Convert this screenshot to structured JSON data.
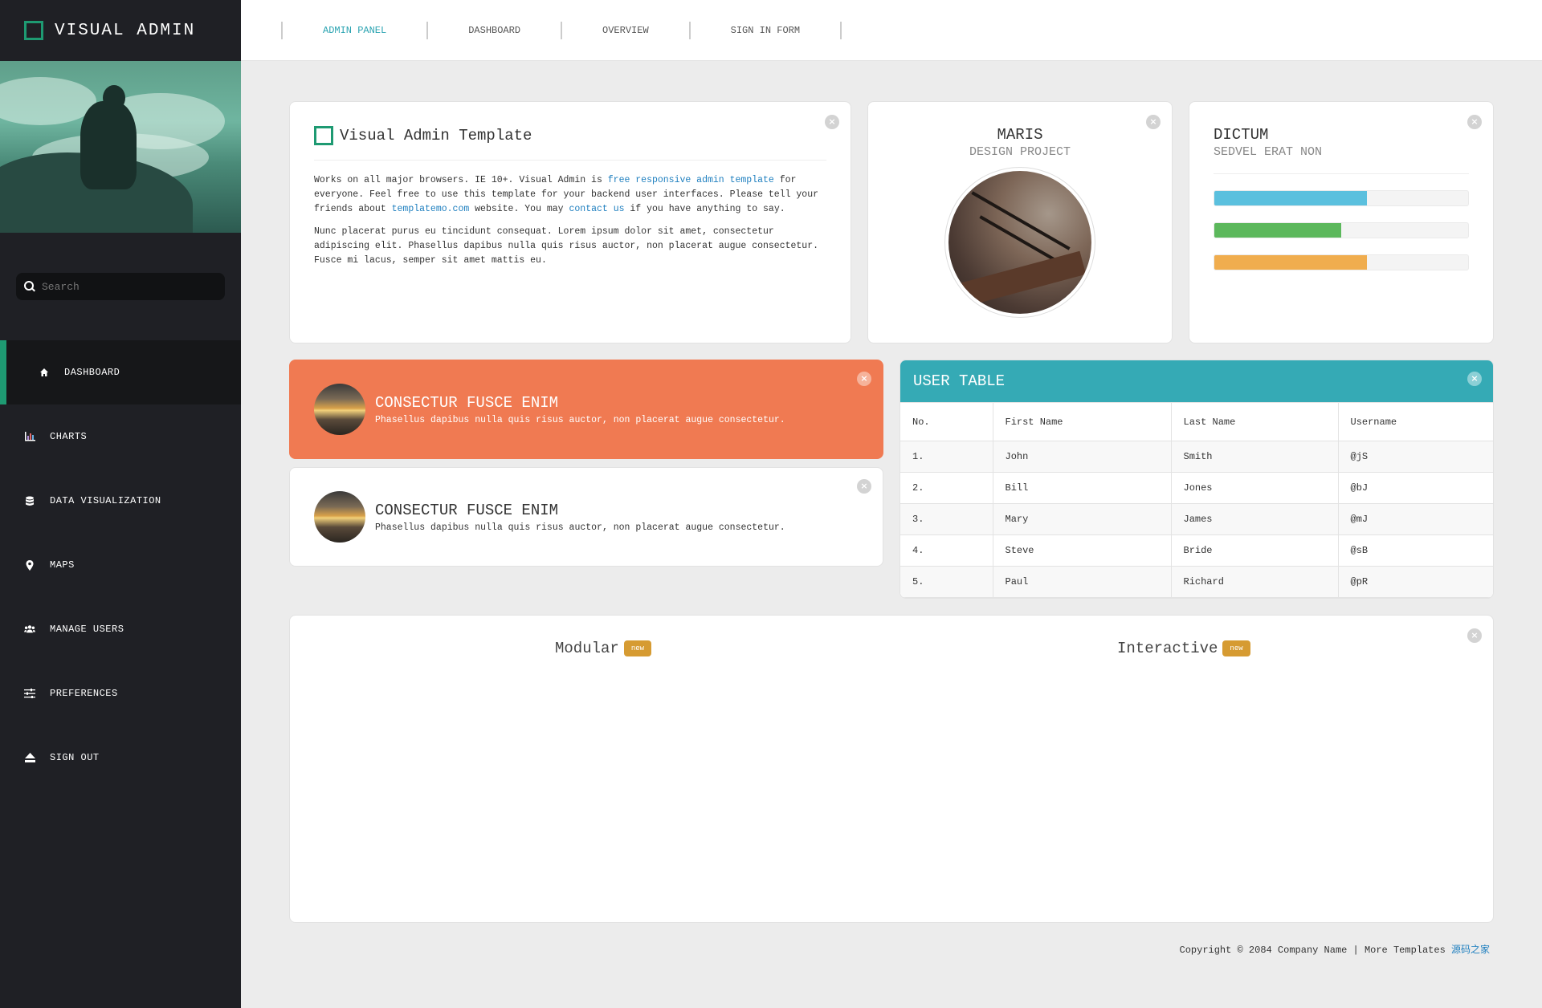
{
  "brand": {
    "title": "VISUAL ADMIN"
  },
  "search": {
    "placeholder": "Search"
  },
  "sidebar": {
    "items": [
      {
        "label": "DASHBOARD",
        "icon": "home-icon",
        "active": true
      },
      {
        "label": "CHARTS",
        "icon": "bar-chart-icon"
      },
      {
        "label": "DATA VISUALIZATION",
        "icon": "database-icon"
      },
      {
        "label": "MAPS",
        "icon": "map-marker-icon"
      },
      {
        "label": "MANAGE USERS",
        "icon": "users-icon"
      },
      {
        "label": "PREFERENCES",
        "icon": "sliders-icon"
      },
      {
        "label": "SIGN OUT",
        "icon": "eject-icon"
      }
    ]
  },
  "topnav": {
    "links": [
      "ADMIN PANEL",
      "DASHBOARD",
      "OVERVIEW",
      "SIGN IN FORM"
    ],
    "active_index": 0
  },
  "intro": {
    "title": "Visual Admin Template",
    "p1_a": "Works on all major browsers. IE 10+. Visual Admin is ",
    "p1_link1": "free responsive admin template",
    "p1_b": " for everyone. Feel free to use this template for your backend user interfaces. Please tell your friends about ",
    "p1_link2": "templatemo.com",
    "p1_c": " website. You may ",
    "p1_link3": "contact us",
    "p1_d": " if you have anything to say.",
    "p2": "Nunc placerat purus eu tincidunt consequat. Lorem ipsum dolor sit amet, consectetur adipiscing elit. Phasellus dapibus nulla quis risus auctor, non placerat augue consectetur. Fusce mi lacus, semper sit amet mattis eu."
  },
  "profile": {
    "name": "MARIS",
    "subtitle": "DESIGN PROJECT"
  },
  "progress": {
    "name": "DICTUM",
    "subtitle": "SEDVEL ERAT NON",
    "bars": [
      {
        "value": 0.6,
        "color": "#5bc0de"
      },
      {
        "value": 0.5,
        "color": "#5cb85c"
      },
      {
        "value": 0.6,
        "color": "#f0ad4e"
      }
    ]
  },
  "media": [
    {
      "title": "CONSECTUR FUSCE ENIM",
      "text": "Phasellus dapibus nulla quis risus auctor, non placerat augue consectetur."
    },
    {
      "title": "CONSECTUR FUSCE ENIM",
      "text": "Phasellus dapibus nulla quis risus auctor, non placerat augue consectetur."
    }
  ],
  "user_table": {
    "title": "USER TABLE",
    "columns": [
      "No.",
      "First Name",
      "Last Name",
      "Username"
    ],
    "rows": [
      [
        "1.",
        "John",
        "Smith",
        "@jS"
      ],
      [
        "2.",
        "Bill",
        "Jones",
        "@bJ"
      ],
      [
        "3.",
        "Mary",
        "James",
        "@mJ"
      ],
      [
        "4.",
        "Steve",
        "Bride",
        "@sB"
      ],
      [
        "5.",
        "Paul",
        "Richard",
        "@pR"
      ]
    ]
  },
  "features": [
    {
      "label": "Modular",
      "badge": "new"
    },
    {
      "label": "Interactive",
      "badge": "new"
    }
  ],
  "footer": {
    "text": "Copyright © 2084 Company Name | More Templates ",
    "link": "源码之家"
  },
  "colors": {
    "accent": "#1e9a72",
    "teal": "#35aab5",
    "orange": "#f07a52",
    "sidebar": "#1f2025"
  }
}
